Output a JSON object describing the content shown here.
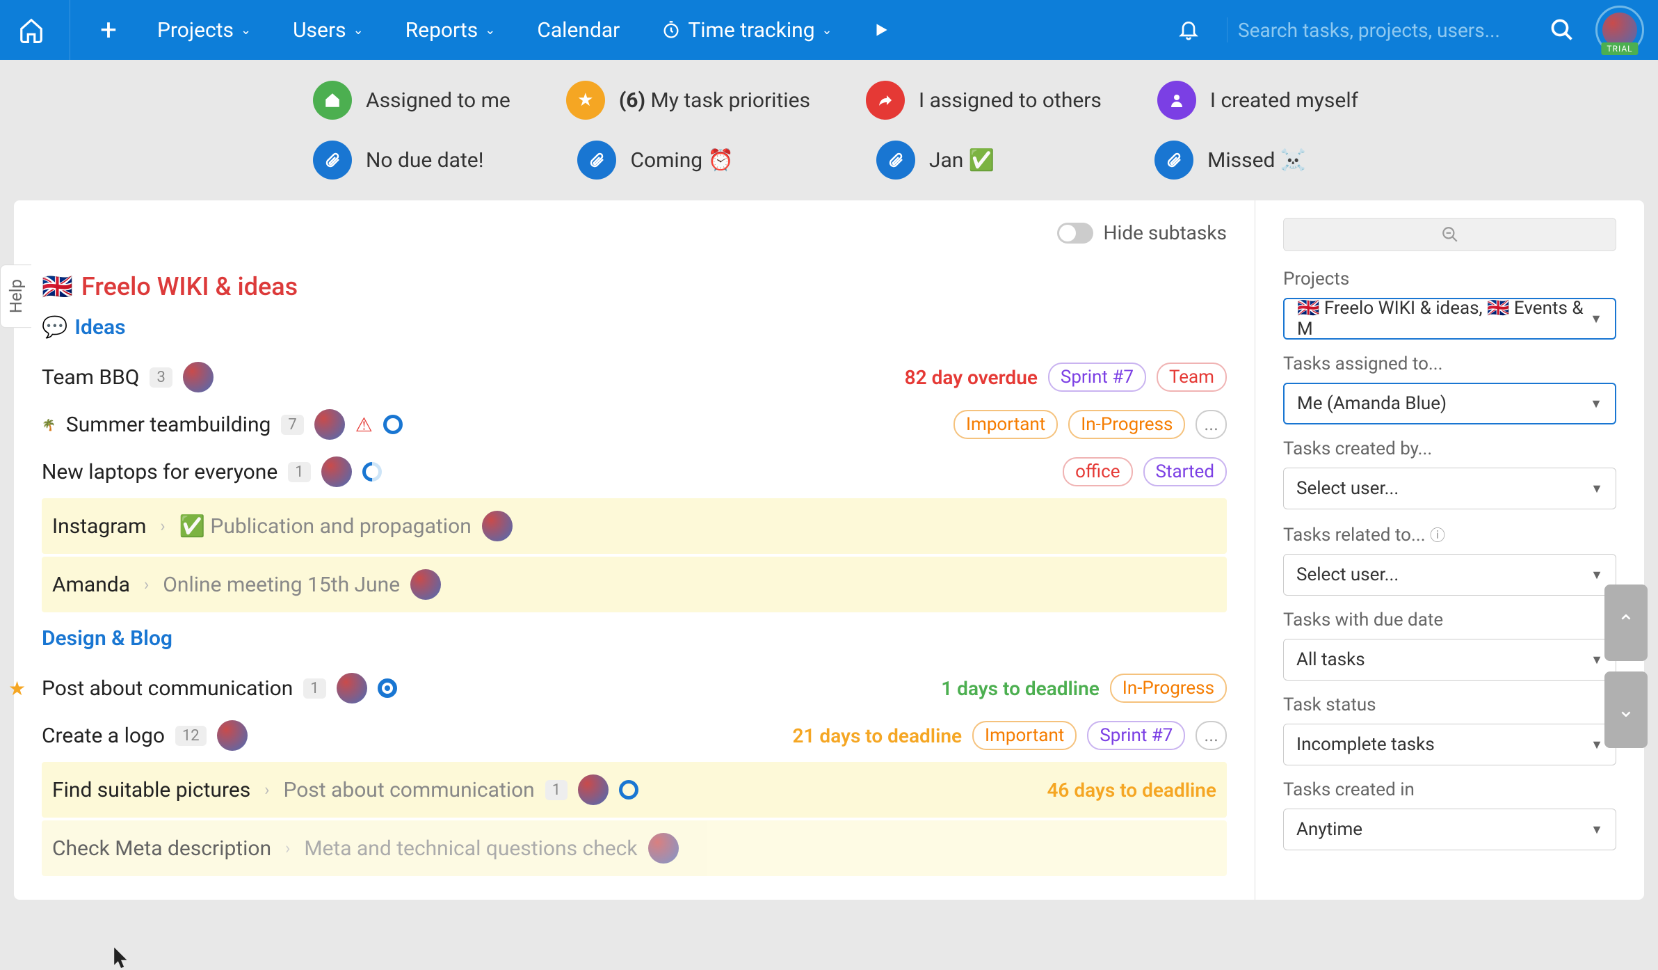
{
  "nav": {
    "projects": "Projects",
    "users": "Users",
    "reports": "Reports",
    "calendar": "Calendar",
    "time_tracking": "Time tracking",
    "search_placeholder": "Search tasks, projects, users...",
    "trial": "TRIAL"
  },
  "filters": {
    "assigned_to_me": "Assigned to me",
    "priorities_count": "(6)",
    "priorities_label": "My task priorities",
    "assigned_others": "I assigned to others",
    "created_myself": "I created myself",
    "no_due": "No due date!",
    "coming": "Coming ⏰",
    "jan": "Jan ✅",
    "missed": "Missed ☠️"
  },
  "panel": {
    "hide_subtasks": "Hide subtasks",
    "project_flag": "🇬🇧",
    "project_title": "Freelo WIKI & ideas",
    "list_ideas": "Ideas",
    "list_design": "Design & Blog"
  },
  "tasks": {
    "t1": {
      "name": "Team BBQ",
      "count": "3",
      "due": "82 day overdue",
      "tags": [
        "Sprint #7",
        "Team"
      ]
    },
    "t2": {
      "emoji": "🌴",
      "name": "Summer teambuilding",
      "count": "7",
      "tags": [
        "Important",
        "In-Progress"
      ]
    },
    "t3": {
      "name": "New laptops for everyone",
      "count": "1",
      "tags": [
        "office",
        "Started"
      ]
    },
    "t4": {
      "name": "Instagram",
      "parent": "✅ Publication and propagation"
    },
    "t5": {
      "name": "Amanda",
      "parent": "Online meeting 15th June"
    },
    "t6": {
      "name": "Post about communication",
      "count": "1",
      "due": "1 days to deadline",
      "tags": [
        "In-Progress"
      ]
    },
    "t7": {
      "name": "Create a logo",
      "count": "12",
      "due": "21 days to deadline",
      "tags": [
        "Important",
        "Sprint #7"
      ]
    },
    "t8": {
      "name": "Find suitable pictures",
      "parent": "Post about communication",
      "count": "1",
      "due": "46 days to deadline"
    },
    "t9": {
      "name": "Check Meta description",
      "parent": "Meta and technical questions check"
    }
  },
  "sidebar": {
    "projects_label": "Projects",
    "projects_value": "🇬🇧 Freelo WIKI & ideas, 🇬🇧 Events & M",
    "assigned_label": "Tasks assigned to...",
    "assigned_value": "Me (Amanda Blue)",
    "created_label": "Tasks created by...",
    "created_value": "Select user...",
    "related_label": "Tasks related to...",
    "related_value": "Select user...",
    "due_label": "Tasks with due date",
    "due_value": "All tasks",
    "status_label": "Task status",
    "status_value": "Incomplete tasks",
    "createdin_label": "Tasks created in",
    "createdin_value": "Anytime"
  },
  "help": "Help"
}
